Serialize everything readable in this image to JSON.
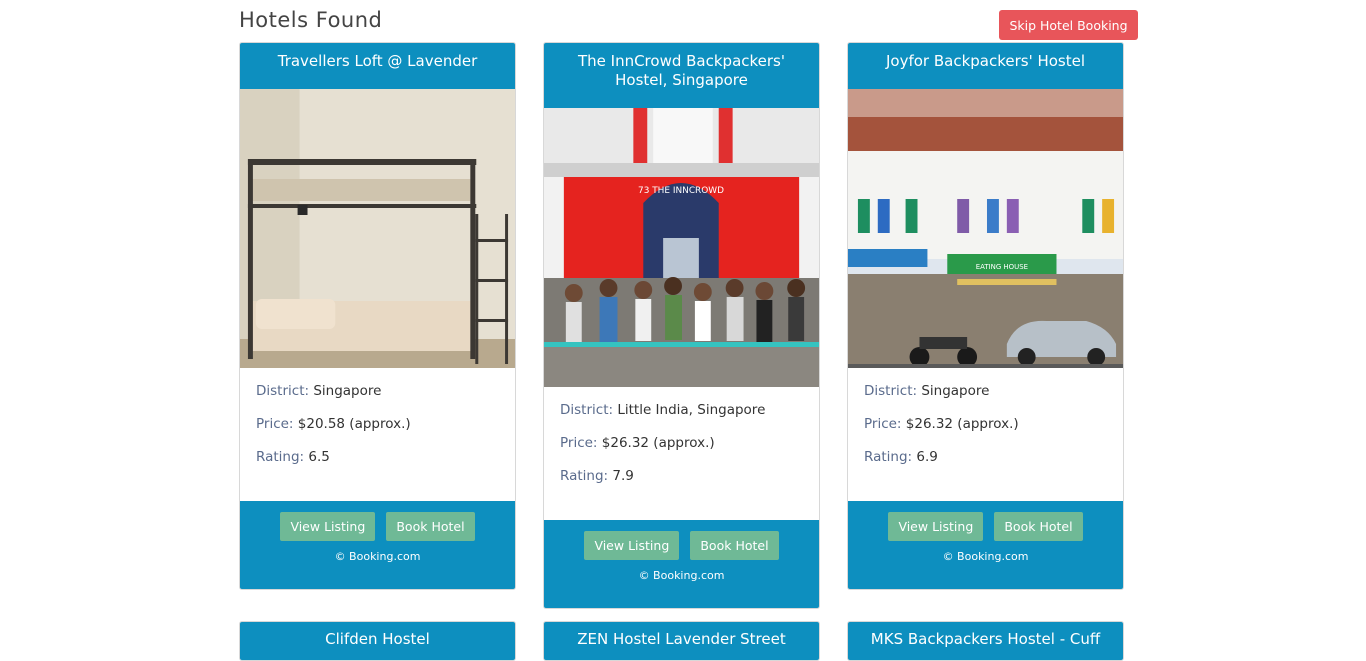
{
  "page": {
    "title": "Hotels Found",
    "skip_label": "Skip Hotel Booking"
  },
  "labels": {
    "district": "District:",
    "price": "Price:",
    "rating": "Rating:"
  },
  "hotels": [
    {
      "name": "Travellers Loft @ Lavender",
      "district": "Singapore",
      "price": "$20.58 (approx.)",
      "rating": "6.5",
      "view_label": "View Listing",
      "book_label": "Book Hotel",
      "copyright": "© Booking.com"
    },
    {
      "name": "The InnCrowd Backpackers' Hostel, Singapore",
      "district": "Little India, Singapore",
      "price": "$26.32 (approx.)",
      "rating": "7.9",
      "view_label": "View Listing",
      "book_label": "Book Hotel",
      "copyright": "© Booking.com",
      "sign_text": "73 THE INNCROWD"
    },
    {
      "name": "Joyfor Backpackers' Hostel",
      "district": "Singapore",
      "price": "$26.32 (approx.)",
      "rating": "6.9",
      "view_label": "View Listing",
      "book_label": "Book Hotel",
      "copyright": "© Booking.com",
      "sign_text": "EATING HOUSE"
    },
    {
      "name": "Clifden Hostel"
    },
    {
      "name": "ZEN Hostel Lavender Street"
    },
    {
      "name": "MKS Backpackers Hostel - Cuff"
    }
  ],
  "colors": {
    "header": "#0d8fbf",
    "button": "#6fb996",
    "skip": "#e8555a"
  }
}
